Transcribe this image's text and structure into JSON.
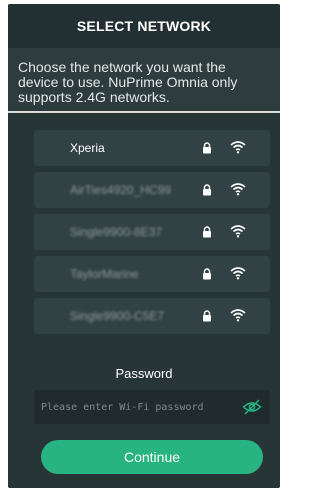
{
  "header": {
    "title": "SELECT NETWORK"
  },
  "instructions": "Choose the network you want the device to use. NuPrime Omnia only supports 2.4G networks.",
  "networks": [
    {
      "name": "Xperia",
      "secured": true,
      "icon_lock": "lock-icon",
      "icon_signal": "wifi-icon"
    },
    {
      "name": "AirTies4920_HC99",
      "secured": true,
      "icon_lock": "lock-icon",
      "icon_signal": "wifi-icon"
    },
    {
      "name": "Single9900-8E37",
      "secured": true,
      "icon_lock": "lock-icon",
      "icon_signal": "wifi-icon"
    },
    {
      "name": "TaylorMarine",
      "secured": true,
      "icon_lock": "lock-icon",
      "icon_signal": "wifi-icon"
    },
    {
      "name": "Single9900-C5E7",
      "secured": true,
      "icon_lock": "lock-icon",
      "icon_signal": "wifi-icon"
    }
  ],
  "password": {
    "label": "Password",
    "placeholder": "Please enter Wi-Fi password",
    "value": "",
    "toggle_icon": "eye-slash-icon"
  },
  "continue_label": "Continue",
  "colors": {
    "background": "#283537",
    "accent": "#27b382",
    "text": "#ffffff"
  }
}
